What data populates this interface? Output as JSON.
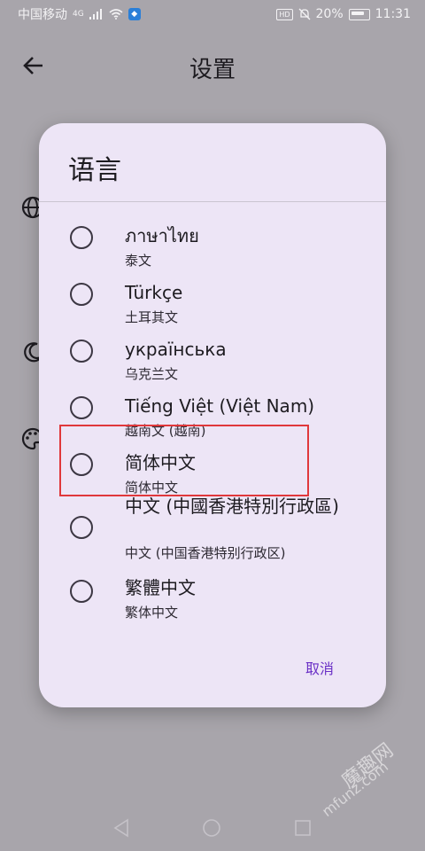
{
  "status_bar": {
    "carrier": "中国移动",
    "network_type": "4G",
    "hd_badge": "HD",
    "battery_percent": "20%",
    "time": "11:31"
  },
  "app_bar": {
    "title": "设置"
  },
  "dialog": {
    "title": "语言",
    "options": [
      {
        "label": "ภาษาไทย",
        "sublabel": "泰文",
        "selected": false
      },
      {
        "label": "Türkçe",
        "sublabel": "土耳其文",
        "selected": false
      },
      {
        "label": "українська",
        "sublabel": "乌克兰文",
        "selected": false
      },
      {
        "label": "Tiếng Việt (Việt Nam)",
        "sublabel": "越南文 (越南)",
        "selected": false
      },
      {
        "label": "简体中文",
        "sublabel": "简体中文",
        "selected": false
      },
      {
        "label": "中文 (中國香港特別行政區)",
        "sublabel": "中文 (中国香港特别行政区)",
        "selected": false
      },
      {
        "label": "繁體中文",
        "sublabel": "繁体中文",
        "selected": false
      }
    ],
    "cancel_label": "取消"
  },
  "watermark": {
    "text": "魔趣网",
    "sub": "mfunz.com"
  },
  "colors": {
    "scrim_background": "#a8a5ab",
    "dialog_background": "#ede5f6",
    "accent": "#6a2fc6",
    "highlight": "#e0383b"
  },
  "icons": [
    "signal-icon",
    "wifi-icon",
    "shield-icon",
    "mute-icon",
    "battery-icon",
    "back-arrow-icon",
    "globe-icon",
    "moon-icon",
    "palette-icon",
    "nav-back-icon",
    "nav-home-icon",
    "nav-recent-icon"
  ]
}
